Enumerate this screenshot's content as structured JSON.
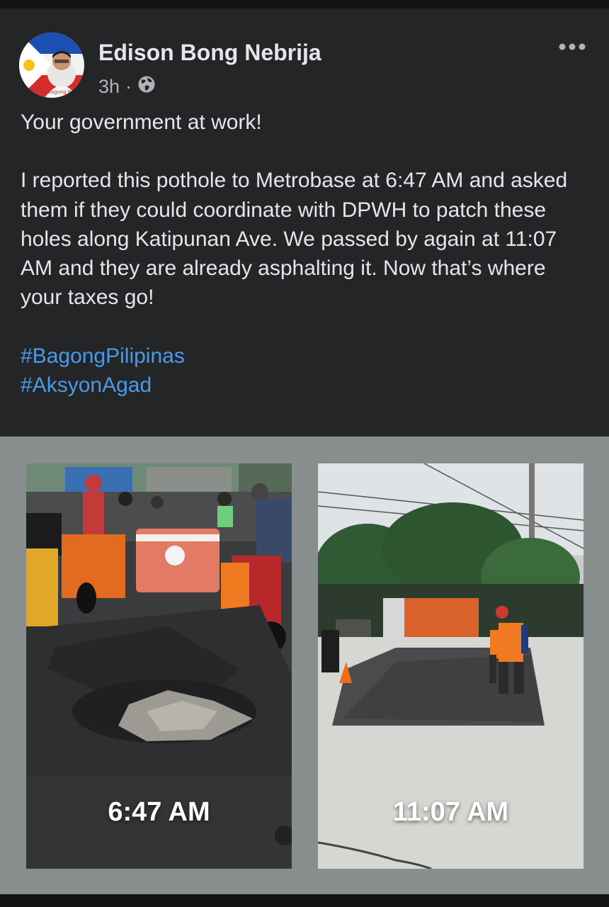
{
  "post": {
    "author": "Edison Bong Nebrija",
    "time": "3h",
    "separator": "·",
    "audience_icon": "globe-icon",
    "menu_icon": "more-horizontal-icon",
    "paragraphs": [
      "Your government at work!",
      "I reported this pothole to Metrobase at 6:47 AM and asked them if they could coordinate with DPWH to patch these holes along Katipunan Ave. We passed by again at 11:07 AM and they are already asphalting it. Now that’s where your taxes go!"
    ],
    "hashtags": [
      "#BagongPilipinas",
      "#AksyonAgad"
    ]
  },
  "photos": [
    {
      "timestamp": "6:47 AM"
    },
    {
      "timestamp": "11:07 AM"
    }
  ],
  "colors": {
    "background": "#242527",
    "text": "#e4e6eb",
    "muted": "#b0b3b8",
    "link": "#4a9ae8",
    "gallery": "#888d8d"
  }
}
